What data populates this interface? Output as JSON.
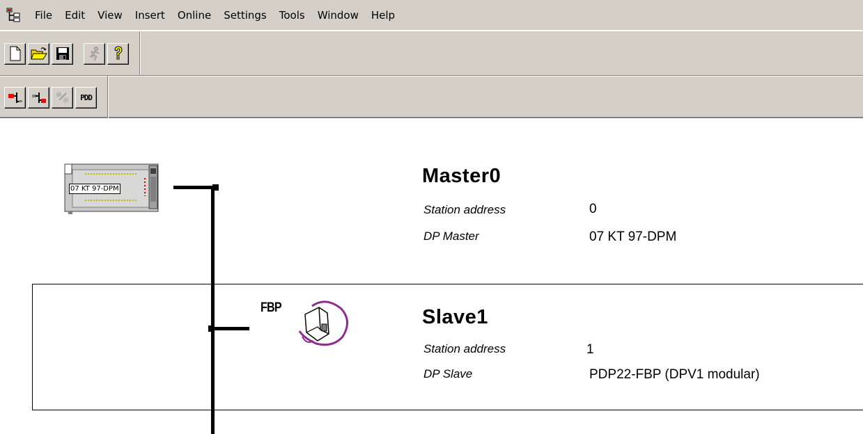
{
  "menu": {
    "items": [
      "File",
      "Edit",
      "View",
      "Insert",
      "Online",
      "Settings",
      "Tools",
      "Window",
      "Help"
    ]
  },
  "toolbar_main": {
    "buttons": [
      "new-icon",
      "open-icon",
      "save-icon",
      "run-icon",
      "help-icon"
    ]
  },
  "toolbar_network": {
    "buttons": [
      "insert-master-icon",
      "insert-slave-icon",
      "replace-icon",
      "pdd-button"
    ],
    "pdd_label": "PDD"
  },
  "master": {
    "device_label": "07 KT 97-DPM",
    "title": "Master0",
    "station_address_label": "Station address",
    "station_address_value": "0",
    "type_label": "DP Master",
    "type_value": "07 KT 97-DPM"
  },
  "slave": {
    "icon_text": "FBP",
    "title": "Slave1",
    "station_address_label": "Station address",
    "station_address_value": "1",
    "type_label": "DP Slave",
    "type_value": "PDP22-FBP (DPV1 modular)"
  },
  "colors": {
    "chrome": "#d4d0c8",
    "accent_red": "#ff0000",
    "fbp_purple": "#8e2d8e"
  }
}
